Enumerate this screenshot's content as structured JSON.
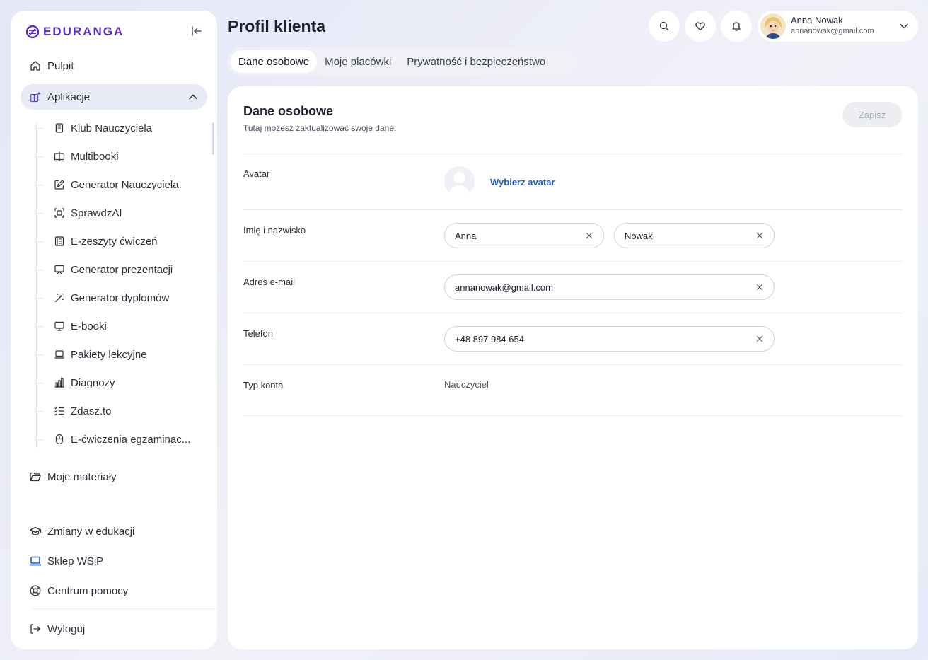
{
  "brand": {
    "name": "EDURANGA",
    "color": "#5a2bc6"
  },
  "sidebar": {
    "items": [
      {
        "label": "Pulpit",
        "icon": "home-icon"
      },
      {
        "label": "Aplikacje",
        "icon": "apps-icon",
        "expanded": true
      }
    ],
    "apps": [
      {
        "label": "Klub Nauczyciela",
        "icon": "notebook-icon"
      },
      {
        "label": "Multibooki",
        "icon": "book-open-icon"
      },
      {
        "label": "Generator Nauczyciela",
        "icon": "edit-icon"
      },
      {
        "label": "SprawdzAI",
        "icon": "scan-icon"
      },
      {
        "label": "E-zeszyty ćwiczeń",
        "icon": "workbook-icon"
      },
      {
        "label": "Generator prezentacji",
        "icon": "presentation-icon"
      },
      {
        "label": "Generator dyplomów",
        "icon": "magic-wand-icon"
      },
      {
        "label": "E-booki",
        "icon": "monitor-icon"
      },
      {
        "label": "Pakiety lekcyjne",
        "icon": "laptop-icon"
      },
      {
        "label": "Diagnozy",
        "icon": "bar-chart-icon"
      },
      {
        "label": "Zdasz.to",
        "icon": "checklist-icon"
      },
      {
        "label": "E-ćwiczenia egzaminac...",
        "icon": "mouse-icon"
      }
    ],
    "materials": {
      "label": "Moje materiały",
      "icon": "folder-icon"
    },
    "bottom": [
      {
        "label": "Zmiany w edukacji",
        "icon": "graduation-cap-icon"
      },
      {
        "label": "Sklep WSiP",
        "icon": "shop-laptop-icon"
      },
      {
        "label": "Centrum pomocy",
        "icon": "lifebuoy-icon"
      }
    ],
    "logout": {
      "label": "Wyloguj",
      "icon": "logout-icon"
    }
  },
  "header": {
    "title": "Profil klienta",
    "user": {
      "name": "Anna Nowak",
      "email": "annanowak@gmail.com"
    }
  },
  "tabs": [
    {
      "label": "Dane osobowe",
      "active": true
    },
    {
      "label": "Moje placówki",
      "active": false
    },
    {
      "label": "Prywatność i bezpieczeństwo",
      "active": false
    }
  ],
  "section": {
    "title": "Dane osobowe",
    "subtitle": "Tutaj możesz zaktualizować swoje dane.",
    "save_label": "Zapisz"
  },
  "form": {
    "avatar": {
      "label": "Avatar",
      "action": "Wybierz avatar"
    },
    "name": {
      "label": "Imię i nazwisko",
      "first": "Anna",
      "last": "Nowak"
    },
    "email": {
      "label": "Adres e-mail",
      "value": "annanowak@gmail.com"
    },
    "phone": {
      "label": "Telefon",
      "value": "+48 897 984 654"
    },
    "account_type": {
      "label": "Typ konta",
      "value": "Nauczyciel"
    }
  },
  "colors": {
    "accent_link": "#1d5fc4",
    "active_bg": "#e8ebf5"
  }
}
